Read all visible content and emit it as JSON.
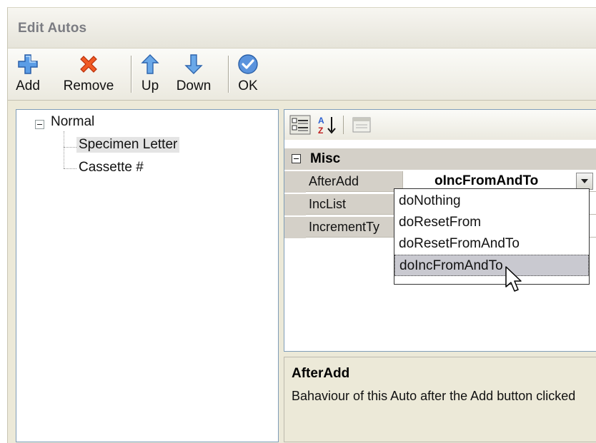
{
  "window": {
    "title": "Edit Autos"
  },
  "toolbar": {
    "add_label": "Add",
    "remove_label": "Remove",
    "up_label": "Up",
    "down_label": "Down",
    "ok_label": "OK"
  },
  "tree": {
    "root": "Normal",
    "children": [
      "Specimen Letter",
      "Cassette #"
    ],
    "selected": "Specimen Letter"
  },
  "property_grid": {
    "category": "Misc",
    "properties": [
      {
        "name": "AfterAdd",
        "value": "oIncFromAndTo"
      },
      {
        "name": "IncList",
        "value": ""
      },
      {
        "name": "IncrementTy",
        "value": ""
      }
    ],
    "dropdown_options": [
      "doNothing",
      "doResetFrom",
      "doResetFromAndTo",
      "doIncFromAndTo"
    ],
    "dropdown_selected": "doIncFromAndTo"
  },
  "description": {
    "title": "AfterAdd",
    "text": "Bahaviour of this Auto after the Add button clicked"
  },
  "colors": {
    "accent_blue": "#3d7fd6",
    "remove_red": "#e0401c",
    "ok_blue": "#4a86d8"
  }
}
